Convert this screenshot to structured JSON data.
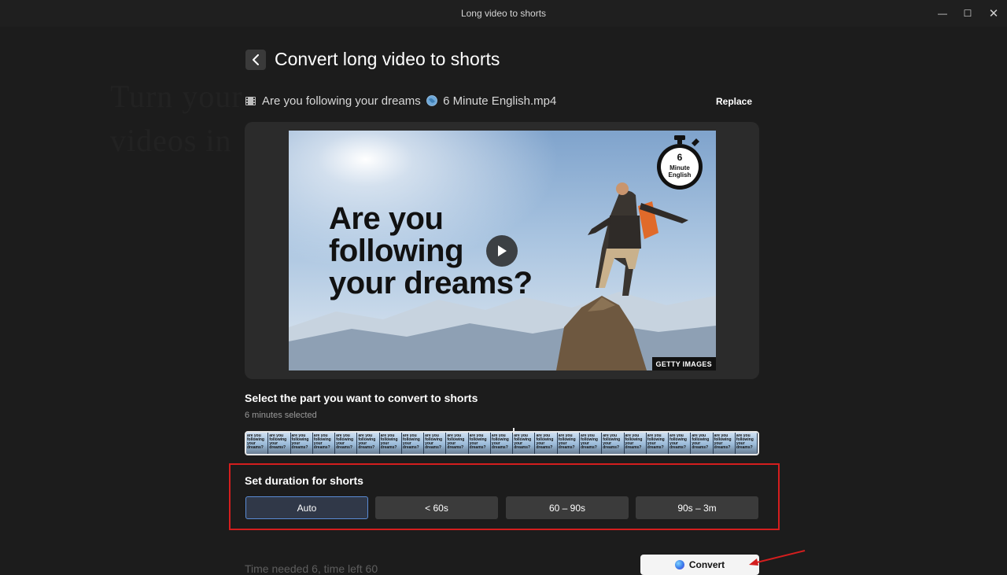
{
  "window": {
    "title": "Long video to shorts",
    "controls": {
      "minimize": "—",
      "maximize": "☐",
      "close": "✕"
    }
  },
  "background_text": {
    "line1": "Turn your",
    "line2": "videos in"
  },
  "header": {
    "title": "Convert long video to shorts"
  },
  "file": {
    "name_part1": "Are you following your dreams",
    "name_part2": "6 Minute English.mp4",
    "replace_label": "Replace"
  },
  "preview": {
    "thumbnail_text_line1": "Are you",
    "thumbnail_text_line2": "following",
    "thumbnail_text_line3": "your dreams?",
    "badge_number": "6",
    "badge_line1": "Minute",
    "badge_line2": "English",
    "credit": "GETTY IMAGES"
  },
  "selection": {
    "label": "Select the part you want to convert to shorts",
    "subtitle": "6 minutes selected",
    "frame_text": "are you following your dreams?",
    "frame_count": 23
  },
  "duration": {
    "label": "Set duration for shorts",
    "options": [
      "Auto",
      "< 60s",
      "60 – 90s",
      "90s – 3m"
    ],
    "selected": "Auto"
  },
  "footer": {
    "status": "Time needed 6, time left 60",
    "convert_label": "Convert"
  },
  "colors": {
    "background": "#1c1c1c",
    "highlight_border": "#d41e1e",
    "selected_border": "#5b8cd6",
    "annotation_arrow": "#d41e1e"
  }
}
